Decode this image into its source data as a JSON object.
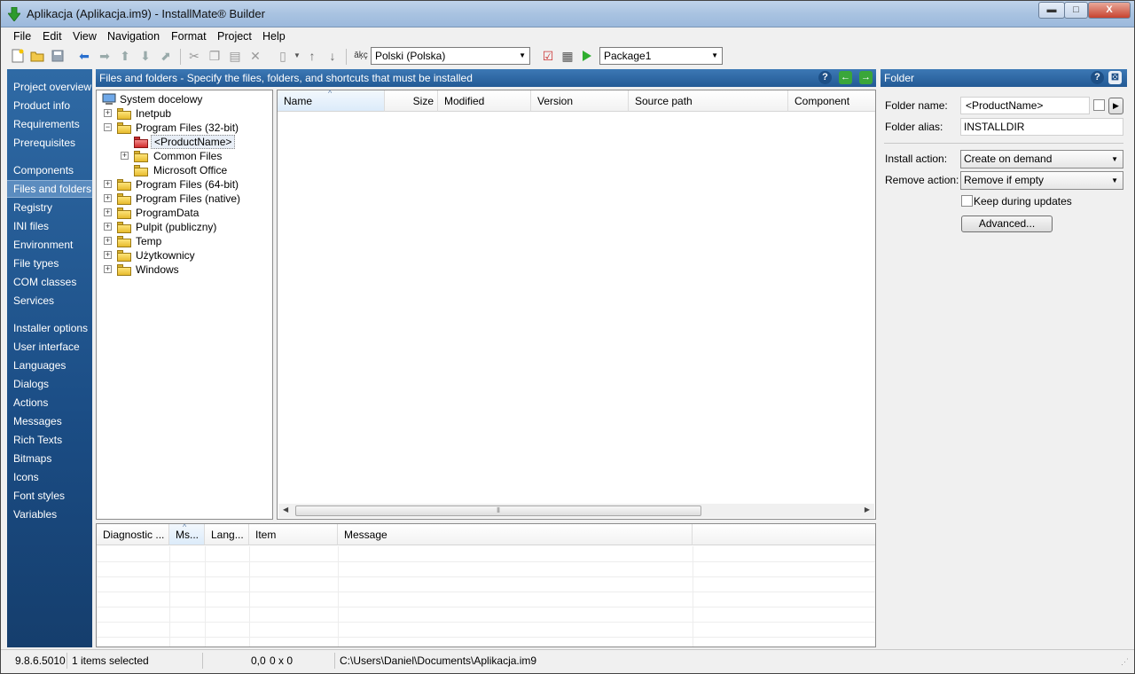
{
  "window": {
    "title": "Aplikacja (Aplikacja.im9) - InstallMate® Builder",
    "min_label": "▬",
    "max_label": "□",
    "close_label": "X"
  },
  "menu": [
    "File",
    "Edit",
    "View",
    "Navigation",
    "Format",
    "Project",
    "Help"
  ],
  "toolbar": {
    "language_icon_text": "āķç",
    "language": "Polski (Polska)",
    "package": "Package1"
  },
  "nav": {
    "items": [
      "Project overview",
      "Product info",
      "Requirements",
      "Prerequisites",
      "Components",
      "Files and folders",
      "Registry",
      "INI files",
      "Environment",
      "File types",
      "COM classes",
      "Services",
      "Installer options",
      "User interface",
      "Languages",
      "Dialogs",
      "Actions",
      "Messages",
      "Rich Texts",
      "Bitmaps",
      "Icons",
      "Font styles",
      "Variables"
    ],
    "selected": "Files and folders"
  },
  "main_header": {
    "title": "Files and folders - Specify the files, folders, and shortcuts that must be installed",
    "help_icon": "?",
    "back_icon": "←",
    "forward_icon": "→"
  },
  "tree": {
    "root": "System docelowy",
    "nodes": [
      "Inetpub",
      "Program Files (32-bit)",
      "<ProductName>",
      "Common Files",
      "Microsoft Office",
      "Program Files (64-bit)",
      "Program Files (native)",
      "ProgramData",
      "Pulpit (publiczny)",
      "Temp",
      "Użytkownicy",
      "Windows"
    ]
  },
  "file_list": {
    "columns": [
      "Name",
      "Size",
      "Modified",
      "Version",
      "Source path",
      "Component"
    ],
    "sort_indicator": "^",
    "scroll_grip": "⦀"
  },
  "messages": {
    "columns": [
      "Diagnostic ...",
      "Ms...",
      "Lang...",
      "Item",
      "Message"
    ],
    "sort_indicator": "^"
  },
  "folder_panel": {
    "header": "Folder",
    "help_icon": "?",
    "pin_icon": "⊠",
    "folder_name_label": "Folder name:",
    "folder_name": "<ProductName>",
    "folder_alias_label": "Folder alias:",
    "folder_alias": "INSTALLDIR",
    "install_action_label": "Install action:",
    "install_action": "Create on demand",
    "remove_action_label": "Remove action:",
    "remove_action": "Remove if empty",
    "keep_label": "Keep during updates",
    "keep_checked": false,
    "advanced_label": "Advanced..."
  },
  "status": {
    "version": "9.8.6.5010",
    "selection": "1 items selected",
    "position": "0,0",
    "size": "0 x 0",
    "path": "C:\\Users\\Daniel\\Documents\\Aplikacja.im9"
  }
}
